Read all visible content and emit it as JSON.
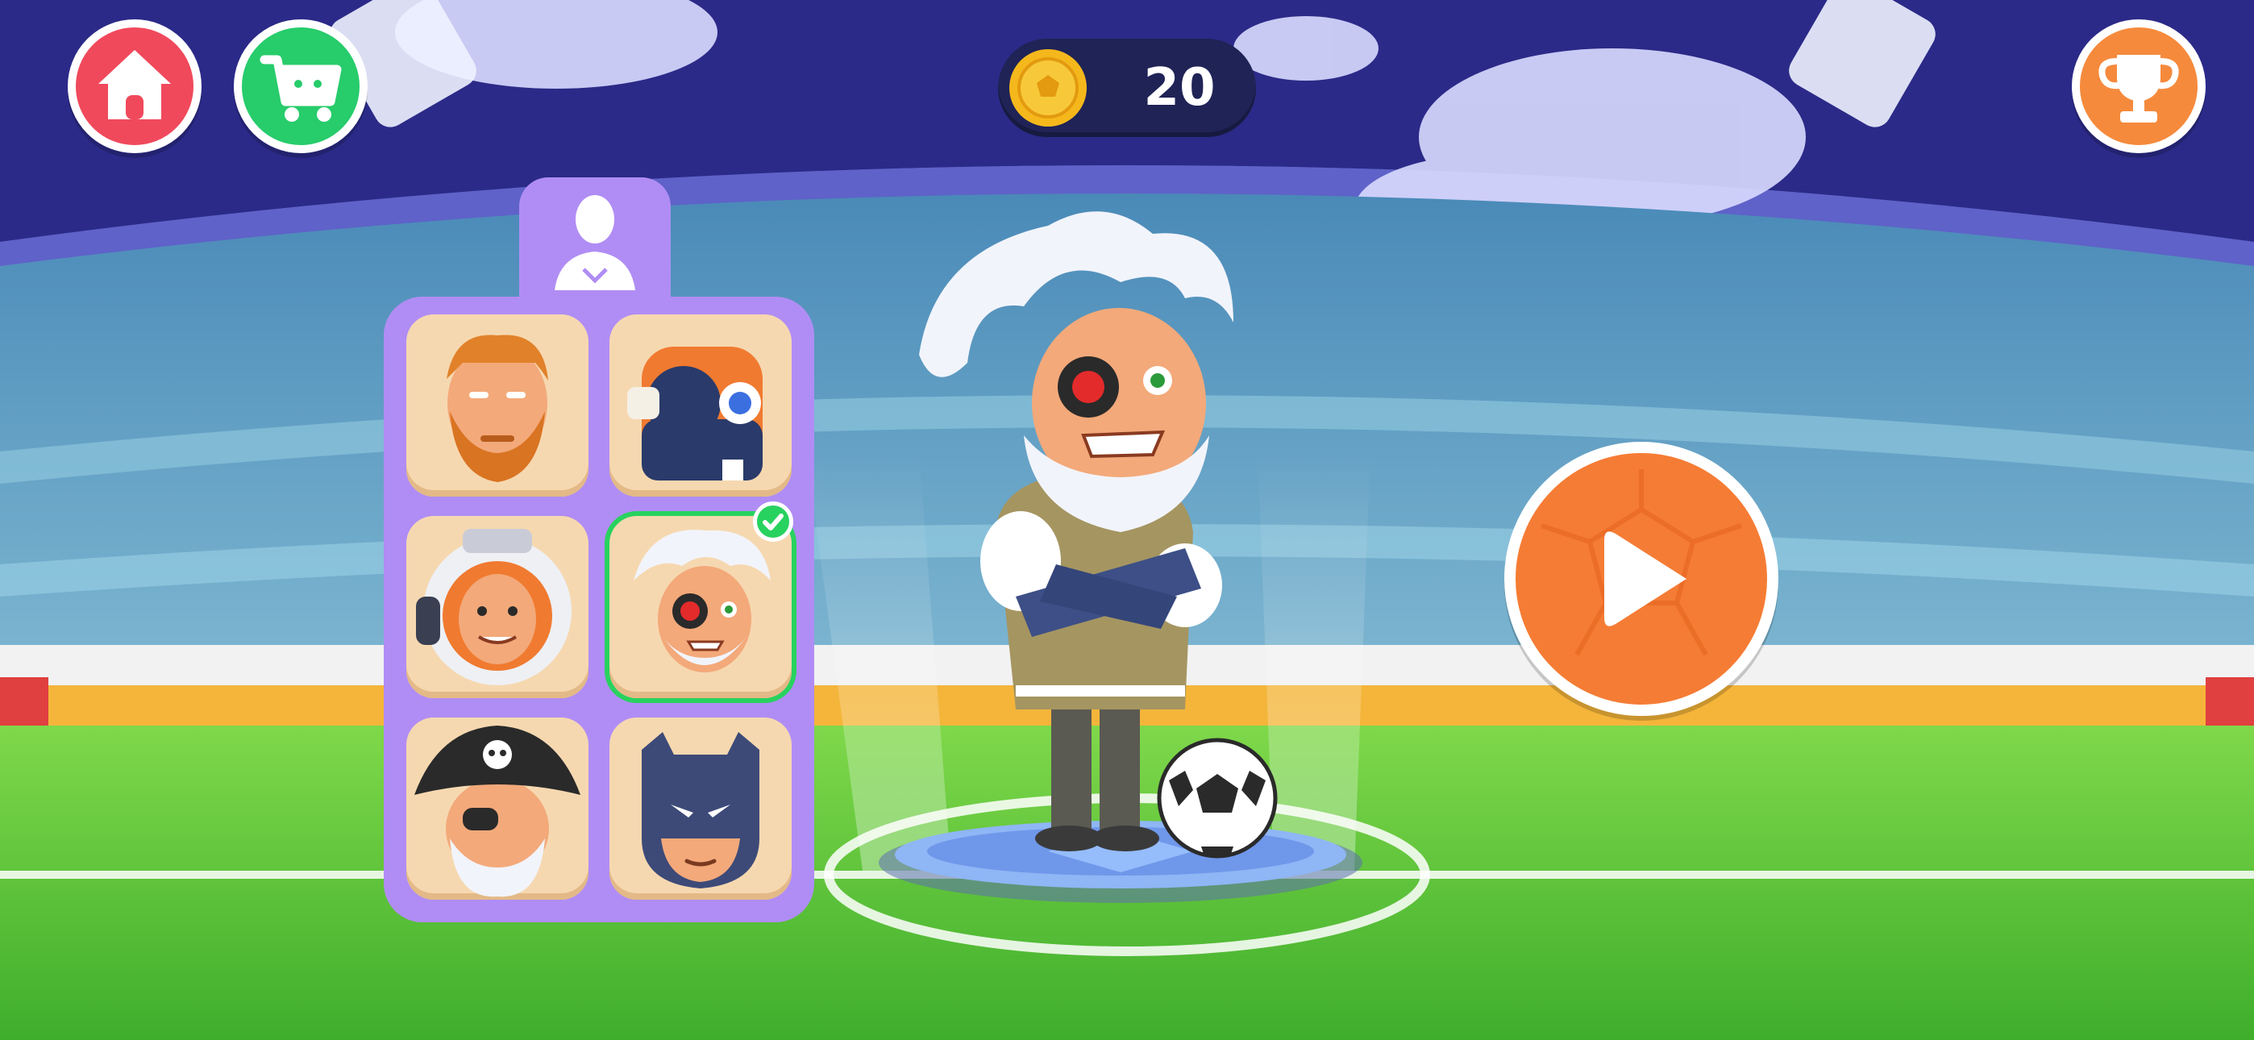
{
  "hud": {
    "home_icon": "home-icon",
    "shop_icon": "cart-icon",
    "trophy_icon": "trophy-icon",
    "coin_icon": "soccer-coin-icon",
    "coin_count": "20"
  },
  "character_panel": {
    "tab_icon": "player-silhouette-icon",
    "characters": [
      {
        "name": "ginger-bearded-hero",
        "selected": false
      },
      {
        "name": "robot",
        "selected": false
      },
      {
        "name": "astronaut",
        "selected": false
      },
      {
        "name": "mad-scientist",
        "selected": true
      },
      {
        "name": "pirate",
        "selected": false
      },
      {
        "name": "masked-hero",
        "selected": false
      }
    ]
  },
  "play_button": {
    "icon": "play-icon"
  },
  "colors": {
    "home": "#f0495c",
    "shop": "#27cc6b",
    "trophy": "#f58a3c",
    "play": "#f57c35",
    "panel": "#b08df4",
    "selected": "#28d25f"
  }
}
